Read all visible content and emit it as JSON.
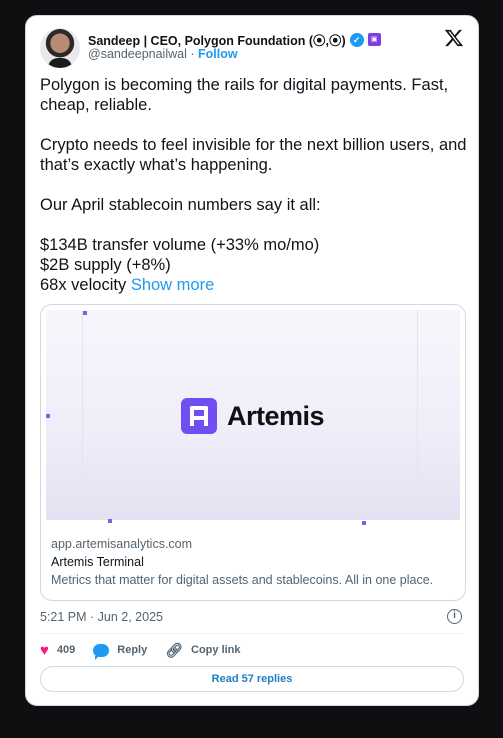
{
  "author": {
    "name": "Sandeep | CEO, Polygon Foundation (⦿,⦿)",
    "handle": "@sandeepnailwal",
    "separator": "·",
    "follow_label": "Follow"
  },
  "post": {
    "lines": [
      "Polygon is becoming the rails for digital payments. Fast, cheap, reliable.",
      "Crypto needs to feel invisible for the next billion users, and that’s exactly what’s happening.",
      "Our April stablecoin numbers say it all:",
      "$134B transfer volume (+33% mo/mo)",
      "$2B supply (+8%)",
      "68x velocity"
    ],
    "show_more": "Show more"
  },
  "link_card": {
    "brand": "Artemis",
    "domain": "app.artemisanalytics.com",
    "title": "Artemis Terminal",
    "description": "Metrics that matter for digital assets and stablecoins. All in one place."
  },
  "timestamp": "5:21 PM · Jun 2, 2025",
  "actions": {
    "likes": "409",
    "reply_label": "Reply",
    "copy_link_label": "Copy link"
  },
  "replies_button": "Read 57 replies",
  "colors": {
    "accent": "#1d9bf0",
    "like": "#f91880",
    "brand": "#6f4ff2"
  },
  "icons": [
    "x-logo-icon",
    "verified-icon",
    "affiliate-badge-icon",
    "info-icon",
    "heart-icon",
    "reply-icon",
    "link-icon"
  ]
}
